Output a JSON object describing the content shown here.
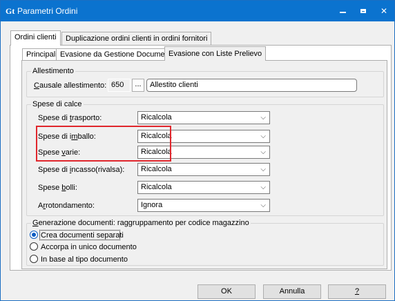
{
  "window": {
    "app_icon": "Gt",
    "title": "Parametri Ordini",
    "controls": {
      "minimize": "–",
      "maximize": "□",
      "close": "✕"
    }
  },
  "outer_tabs": [
    {
      "label": "Ordini clienti",
      "active": true
    },
    {
      "label": "Duplicazione ordini clienti in ordini fornitori",
      "active": false
    }
  ],
  "inner_tabs": [
    {
      "label": "Principali",
      "active": false
    },
    {
      "label": "Evasione da Gestione Documenti",
      "active": false
    },
    {
      "label": "Evasione con Liste Prelievo",
      "active": true
    }
  ],
  "allestimento": {
    "group_label": "Allestimento",
    "causale_label_u": "C",
    "causale_label_rest": "ausale allestimento:",
    "code_value": "650",
    "browse_label": "...",
    "description_value": "Allestito clienti"
  },
  "spese": {
    "group_label": "Spese di calce",
    "rows": [
      {
        "label_pre": "Spese di ",
        "label_u": "t",
        "label_post": "rasporto:",
        "value": "Ricalcola"
      },
      {
        "label_pre": "Spese di i",
        "label_u": "m",
        "label_post": "ballo:",
        "value": "Ricalcola"
      },
      {
        "label_pre": "Spese ",
        "label_u": "v",
        "label_post": "arie:",
        "value": "Ricalcola"
      },
      {
        "label_pre": "Spese di ",
        "label_u": "i",
        "label_post": "ncasso(rivalsa):",
        "value": "Ricalcola"
      },
      {
        "label_pre": "Spese ",
        "label_u": "b",
        "label_post": "olli:",
        "value": "Ricalcola"
      },
      {
        "label_pre": "A",
        "label_u": "r",
        "label_post": "rotondamento:",
        "value": "Ignora"
      }
    ],
    "chevron": "⌵"
  },
  "generazione": {
    "group_label_u": "G",
    "group_label_rest": "enerazione documenti: raggruppamento per codice magazzino",
    "options": [
      {
        "label": "Crea documenti separati",
        "checked": true
      },
      {
        "label": "Accorpa in unico documento",
        "checked": false
      },
      {
        "label": "In base al tipo documento",
        "checked": false
      }
    ]
  },
  "buttons": {
    "ok": "OK",
    "cancel": "Annulla",
    "help": "?"
  }
}
